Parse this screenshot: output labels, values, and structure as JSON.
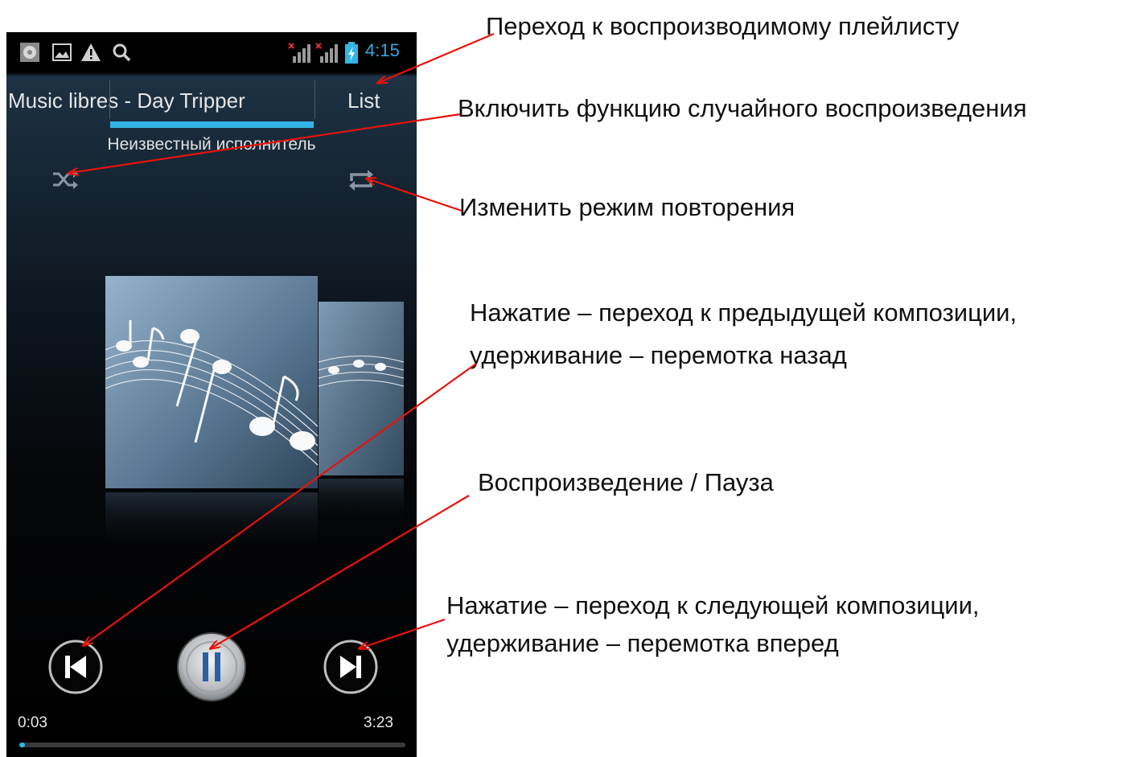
{
  "status_bar": {
    "time": "4:15",
    "left_icons": [
      "app-disc-icon",
      "gallery-icon",
      "warning-icon",
      "search-icon"
    ],
    "right_icons": [
      "signal-no-sim-icon",
      "signal-no-sim-icon",
      "battery-charging-icon"
    ],
    "time_color": "#35a8e0"
  },
  "tabs": {
    "title": "Music libres - Day Tripper",
    "list_label": "List",
    "indicator_color": "#33b5e5"
  },
  "track": {
    "artist": "Неизвестный исполнитель"
  },
  "controls": {
    "shuffle_icon": "shuffle-icon",
    "repeat_icon": "repeat-icon",
    "previous_icon": "skip-previous-icon",
    "play_pause_icon": "pause-icon",
    "next_icon": "skip-next-icon"
  },
  "progress": {
    "elapsed": "0:03",
    "total": "3:23",
    "fraction": 0.015
  },
  "annotations": {
    "playlist": "Переход к воспроизводимому плейлисту",
    "shuffle": "Включить функцию случайного воспроизведения",
    "repeat": "Изменить режим повторения",
    "previous_line1": "Нажатие – переход к предыдущей композиции,",
    "previous_line2": "удерживание – перемотка назад",
    "play_pause": "Воспроизведение / Пауза",
    "next_line1": "Нажатие – переход к следующей композиции,",
    "next_line2": "удерживание – перемотка вперед",
    "arrow_color": "#e8120c"
  }
}
